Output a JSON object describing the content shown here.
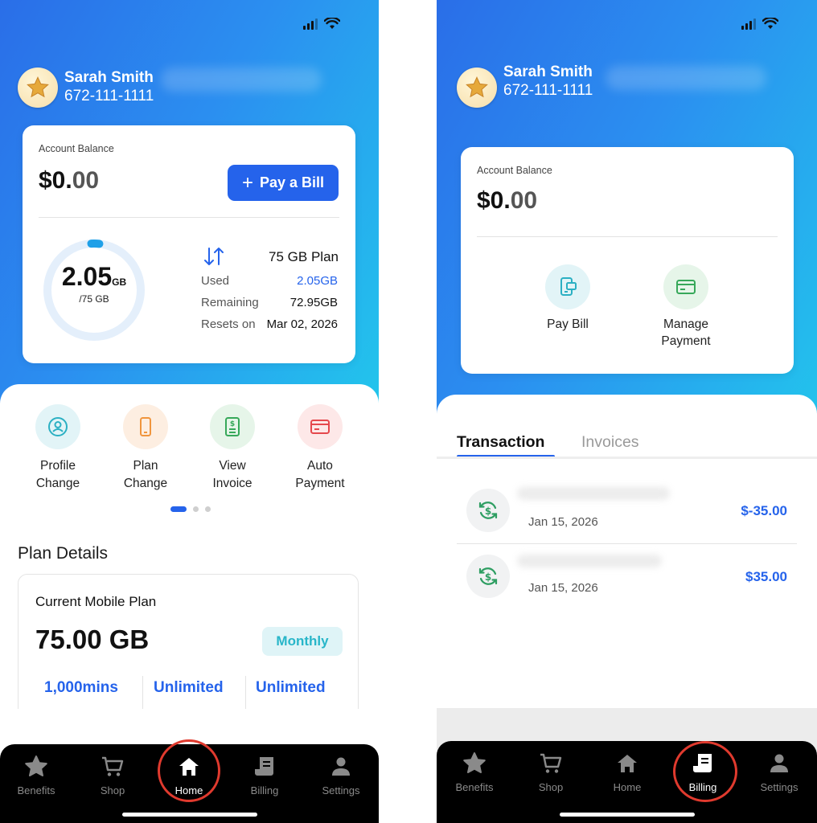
{
  "left": {
    "profile": {
      "name": "Sarah Smith",
      "phone": "672-111-1111"
    },
    "balance_card": {
      "label": "Account Balance",
      "amount_main": "$0.",
      "amount_cents": "00",
      "pay_button_label": "Pay a Bill",
      "usage": {
        "used_value": "2.05",
        "used_unit": "GB",
        "total": "/75 GB",
        "used_fraction": 0.0273,
        "plan_name": "75 GB Plan",
        "rows": [
          {
            "label": "Used",
            "value": "2.05GB"
          },
          {
            "label": "Remaining",
            "value": "72.95GB"
          },
          {
            "label": "Resets on",
            "value": "Mar 02, 2026"
          }
        ]
      }
    },
    "quick_actions": [
      {
        "label": "Profile\nChange",
        "icon": "profile-icon",
        "bg": "#e2f4f7",
        "fg": "#2bb0c3"
      },
      {
        "label": "Plan\nChange",
        "icon": "phone-icon",
        "bg": "#fdeee1",
        "fg": "#f0953d"
      },
      {
        "label": "View\nInvoice",
        "icon": "invoice-icon",
        "bg": "#e6f5e9",
        "fg": "#37a85a"
      },
      {
        "label": "Auto\nPayment",
        "icon": "card-icon",
        "bg": "#fde8e8",
        "fg": "#e5484d"
      }
    ],
    "pager": {
      "count": 3,
      "active": 0
    },
    "plan_details": {
      "title": "Plan Details",
      "card_title": "Current Mobile Plan",
      "plan_size": "75.00 GB",
      "billing_cycle": "Monthly",
      "features": [
        "1,000mins",
        "Unlimited",
        "Unlimited"
      ]
    },
    "nav": {
      "items": [
        {
          "label": "Benefits",
          "icon": "star-icon"
        },
        {
          "label": "Shop",
          "icon": "cart-icon"
        },
        {
          "label": "Home",
          "icon": "home-icon"
        },
        {
          "label": "Billing",
          "icon": "billing-icon"
        },
        {
          "label": "Settings",
          "icon": "person-icon"
        }
      ],
      "active": "Home"
    }
  },
  "right": {
    "profile": {
      "name": "Sarah Smith",
      "phone": "672-111-1111"
    },
    "balance_card": {
      "label": "Account Balance",
      "amount_main": "$0.",
      "amount_cents": "00",
      "actions": [
        {
          "label": "Pay Bill",
          "icon": "pay-bill-icon",
          "bg": "#e2f4f7",
          "fg": "#2bb0c3"
        },
        {
          "label": "Manage\nPayment",
          "icon": "card-icon",
          "bg": "#e6f5e9",
          "fg": "#37a85a"
        }
      ]
    },
    "tabs": [
      {
        "label": "Transaction",
        "active": true
      },
      {
        "label": "Invoices",
        "active": false
      }
    ],
    "transactions": [
      {
        "date": "Jan 15, 2026",
        "amount": "$-35.00",
        "icon": "dollar-refresh-icon"
      },
      {
        "date": "Jan 15, 2026",
        "amount": "$35.00",
        "icon": "dollar-refresh-icon"
      }
    ],
    "nav": {
      "items": [
        {
          "label": "Benefits",
          "icon": "star-icon"
        },
        {
          "label": "Shop",
          "icon": "cart-icon"
        },
        {
          "label": "Home",
          "icon": "home-icon"
        },
        {
          "label": "Billing",
          "icon": "billing-icon"
        },
        {
          "label": "Settings",
          "icon": "person-icon"
        }
      ],
      "active": "Billing"
    }
  },
  "colors": {
    "accent": "#2563eb",
    "highlight_ring": "#e03a2e",
    "gradient_start": "#2a6ee8",
    "gradient_end": "#22c6ec"
  }
}
